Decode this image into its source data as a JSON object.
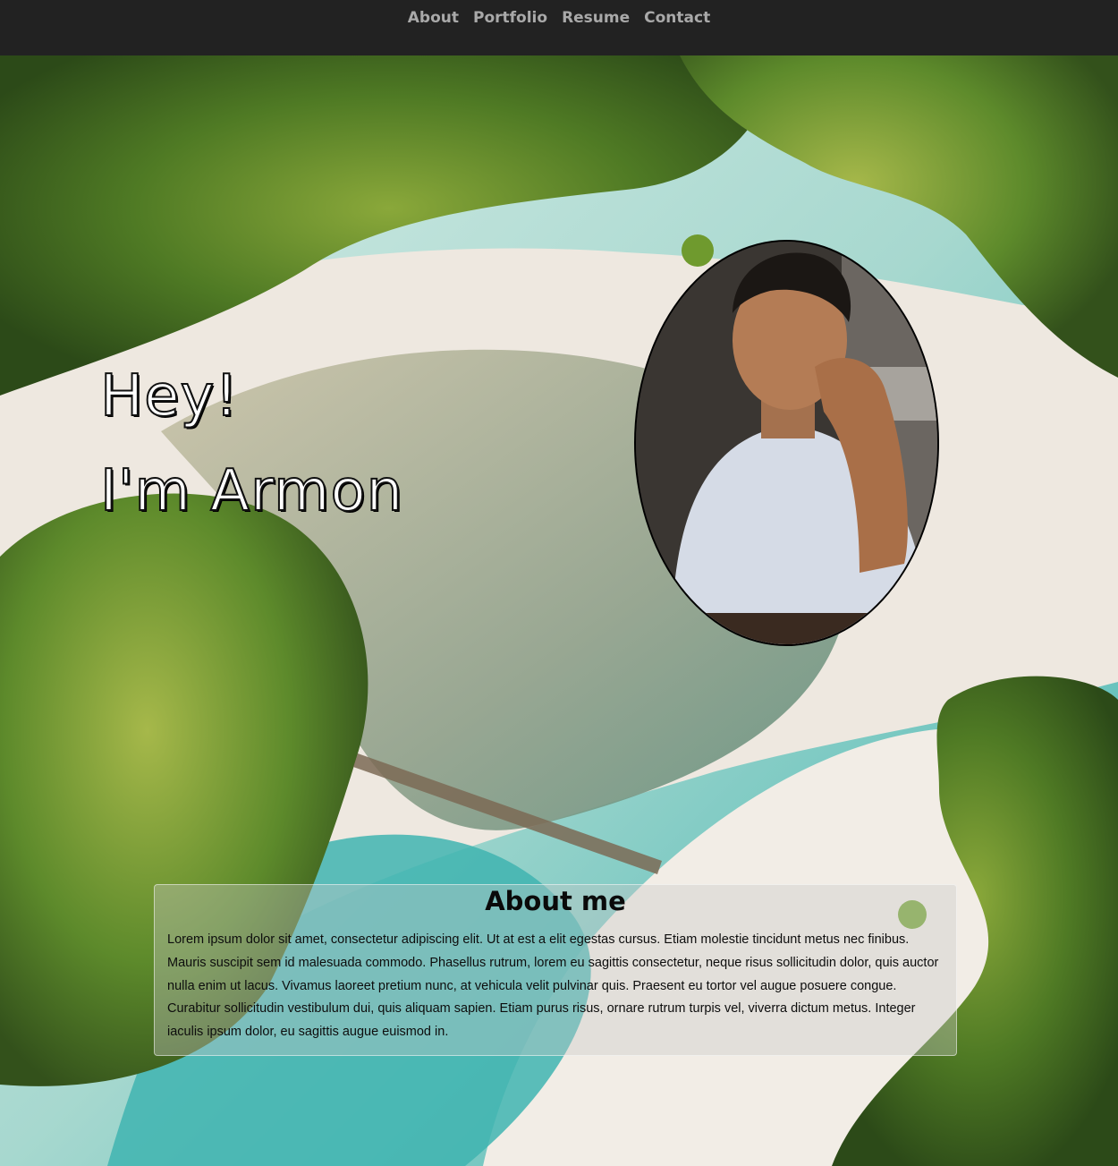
{
  "nav": {
    "links": [
      "About",
      "Portfolio",
      "Resume",
      "Contact"
    ]
  },
  "hero": {
    "line1": "Hey!",
    "line2": "I'm Armon"
  },
  "about": {
    "title": "About me",
    "body": "Lorem ipsum dolor sit amet, consectetur adipiscing elit. Ut at est a elit egestas cursus. Etiam molestie tincidunt metus nec finibus. Mauris suscipit sem id malesuada commodo. Phasellus rutrum, lorem eu sagittis consectetur, neque risus sollicitudin dolor, quis auctor nulla enim ut lacus. Vivamus laoreet pretium nunc, at vehicula velit pulvinar quis. Praesent eu tortor vel augue posuere congue. Curabitur sollicitudin vestibulum dui, quis aliquam sapien. Etiam purus risus, ornare rutrum turpis vel, viverra dictum metus. Integer iaculis ipsum dolor, eu sagittis augue euismod in."
  },
  "colors": {
    "navbar": "#222222",
    "nav_link": "#a9a9a9",
    "forest": "#3f6b22",
    "sand": "#efe9e2",
    "water": "#6fc9c0"
  }
}
